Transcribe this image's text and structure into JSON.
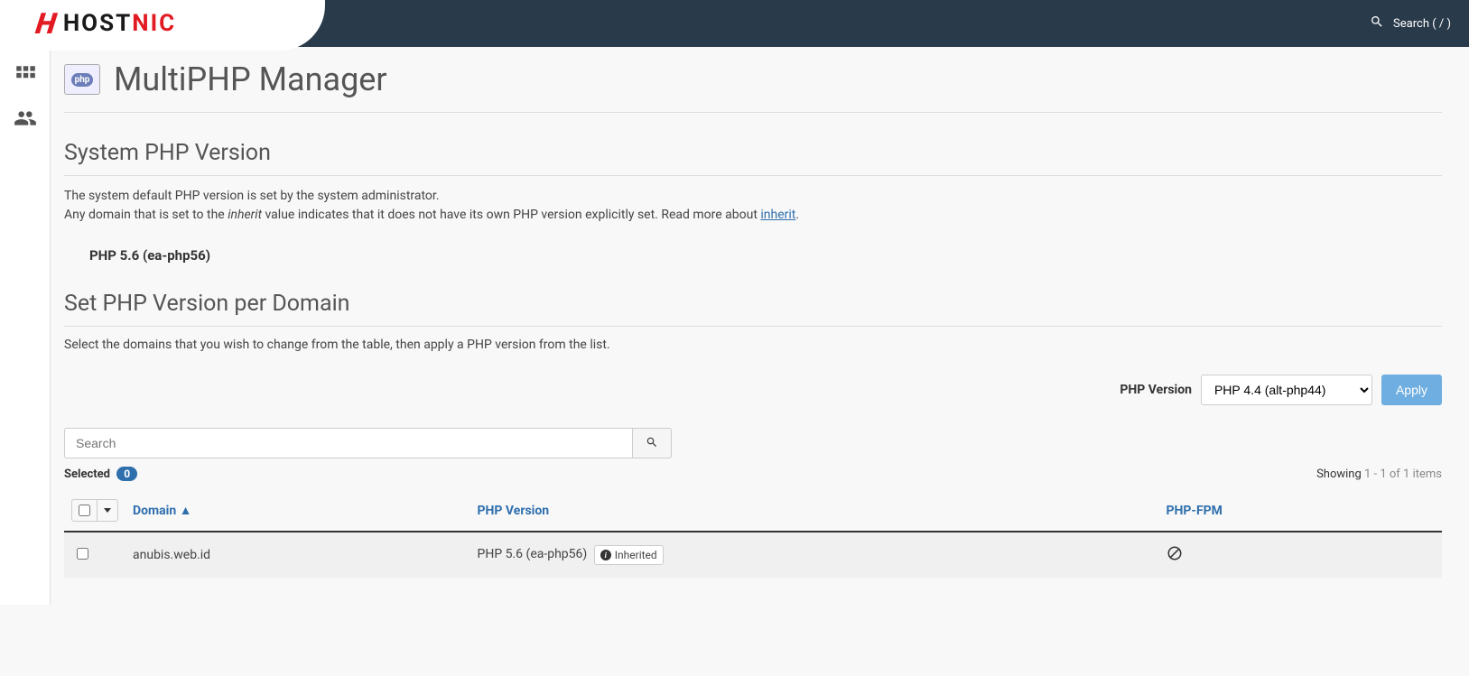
{
  "header": {
    "logo_text_main": "HOST",
    "logo_text_accent": "NIC",
    "search_placeholder": "Search ( / )"
  },
  "page": {
    "title": "MultiPHP Manager",
    "icon_label": "php"
  },
  "system_section": {
    "title": "System PHP Version",
    "desc_1": "The system default PHP version is set by the system administrator.",
    "desc_2a": "Any domain that is set to the ",
    "desc_2_em": "inherit",
    "desc_2b": " value indicates that it does not have its own PHP version explicitly set. Read more about ",
    "desc_link": "inherit",
    "desc_2c": ".",
    "version": "PHP 5.6 (ea-php56)"
  },
  "domain_section": {
    "title": "Set PHP Version per Domain",
    "instruction": "Select the domains that you wish to change from the table, then apply a PHP version from the list.",
    "version_label": "PHP Version",
    "version_selected": "PHP 4.4 (alt-php44)",
    "apply_label": "Apply",
    "search_placeholder": "Search",
    "selected_label": "Selected",
    "selected_count": "0",
    "showing_label": "Showing",
    "showing_value": "1 - 1 of 1 items"
  },
  "table": {
    "col_domain": "Domain ▲",
    "col_version": "PHP Version",
    "col_fpm": "PHP-FPM",
    "rows": [
      {
        "domain": "anubis.web.id",
        "version": "PHP 5.6 (ea-php56)",
        "inherited_label": "Inherited"
      }
    ]
  }
}
